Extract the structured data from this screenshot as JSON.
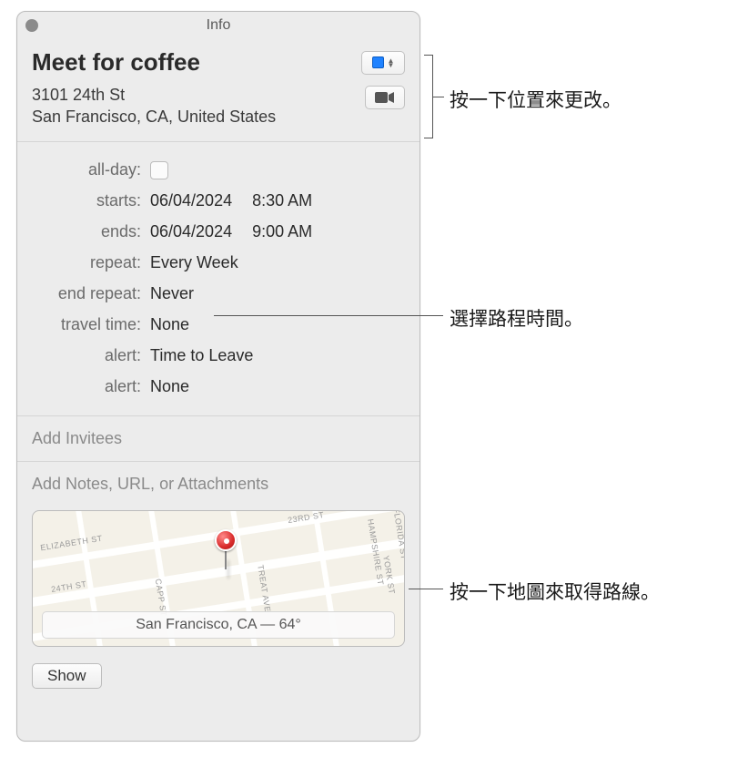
{
  "window": {
    "title": "Info"
  },
  "header": {
    "event_title": "Meet for coffee",
    "location_line1": "3101 24th St",
    "location_line2": "San Francisco, CA, United States",
    "calendar_color": "#1f82ff"
  },
  "fields": {
    "allday_label": "all-day:",
    "allday_checked": false,
    "starts_label": "starts:",
    "starts_date": "06/04/2024",
    "starts_time": "8:30 AM",
    "ends_label": "ends:",
    "ends_date": "06/04/2024",
    "ends_time": "9:00 AM",
    "repeat_label": "repeat:",
    "repeat_value": "Every Week",
    "endrepeat_label": "end repeat:",
    "endrepeat_value": "Never",
    "traveltime_label": "travel time:",
    "traveltime_value": "None",
    "alert1_label": "alert:",
    "alert1_value": "Time to Leave",
    "alert2_label": "alert:",
    "alert2_value": "None"
  },
  "invitees": {
    "placeholder": "Add Invitees"
  },
  "notes": {
    "placeholder": "Add Notes, URL, or Attachments"
  },
  "map": {
    "footer": "San Francisco, CA — 64°",
    "streets": [
      "ELIZABETH ST",
      "24TH ST",
      "23RD ST",
      "HAMPSHIRE ST",
      "YORK ST",
      "TREAT AVE",
      "CAPP ST",
      "FLORIDA ST"
    ]
  },
  "buttons": {
    "show": "Show"
  },
  "callouts": {
    "location": "按一下位置來更改。",
    "traveltime": "選擇路程時間。",
    "map": "按一下地圖來取得路線。"
  }
}
